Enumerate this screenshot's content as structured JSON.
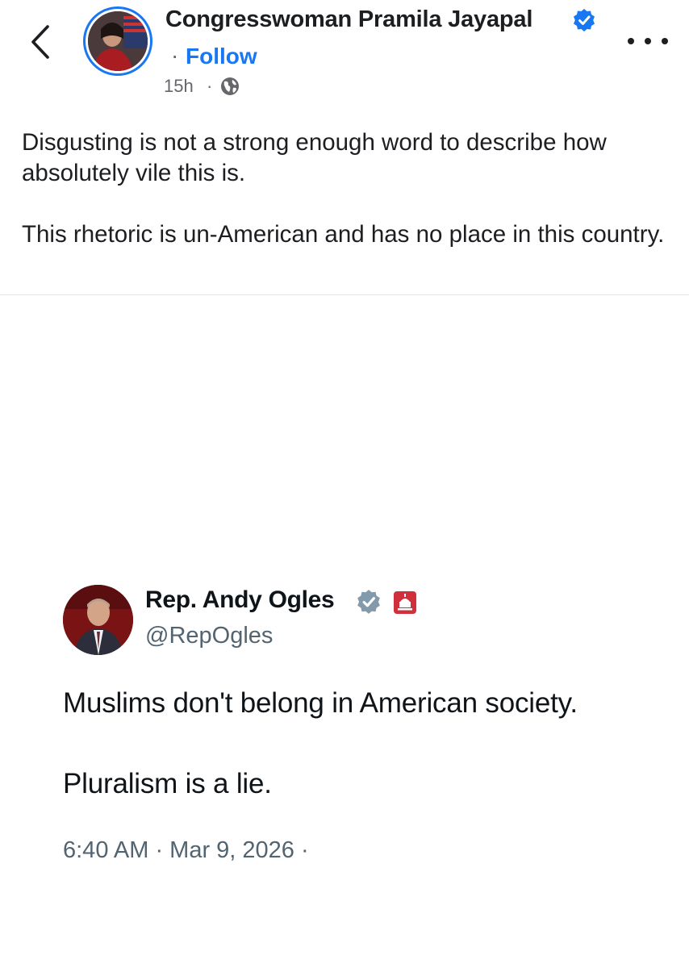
{
  "post": {
    "author": "Congresswoman Pramila Jayapal",
    "follow_separator": "·",
    "follow_label": "Follow",
    "time": "15h",
    "time_separator": "·",
    "privacy_icon": "globe-icon",
    "text_paragraphs": [
      "Disgusting is not a strong enough word to describe how absolutely vile this is.",
      "This rhetoric is un-American and has no place in this country."
    ]
  },
  "embedded_tweet": {
    "name": "Rep. Andy Ogles",
    "handle": "@RepOgles",
    "text_paragraphs": [
      "Muslims don't belong in American society.",
      "Pluralism is a lie."
    ],
    "timestamp": "6:40 AM · Mar 9, 2026 ·"
  },
  "colors": {
    "link_blue": "#1877f2",
    "secondary_text": "#65676b",
    "tweet_gray_badge": "#829aab",
    "gov_badge_red": "#d0303b"
  }
}
